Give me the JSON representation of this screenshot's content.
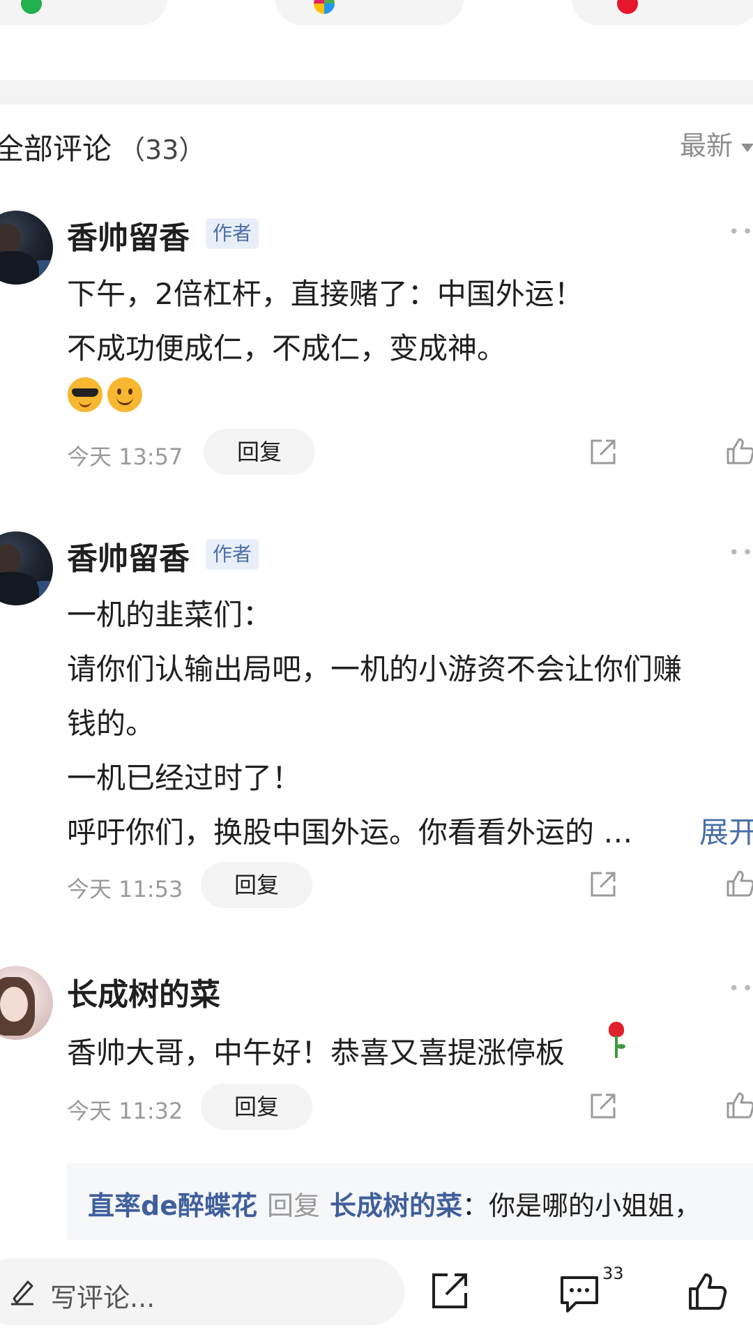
{
  "section": {
    "title": "全部评论",
    "count": "（33）",
    "sort_label": "最新"
  },
  "comments": [
    {
      "username": "香帅留香",
      "badge": "作者",
      "lines": [
        "下午，2倍杠杆，直接赌了：中国外运！",
        "不成功便成仁，不成仁，变成神。"
      ],
      "emojis": [
        "cool-face-emoji",
        "smile-emoji"
      ],
      "time": "今天 13:57",
      "reply_label": "回复"
    },
    {
      "username": "香帅留香",
      "badge": "作者",
      "lines": [
        "一机的韭菜们：",
        "请你们认输出局吧，一机的小游资不会让你们赚",
        "钱的。",
        "一机已经过时了！",
        "呼吁你们，换股中国外运。你看看外运的 …"
      ],
      "expand_label": "展开",
      "time": "今天 11:53",
      "reply_label": "回复"
    },
    {
      "username": "长成树的菜",
      "lines": [
        "香帅大哥，中午好！恭喜又喜提涨停板"
      ],
      "emojis": [
        "rose-emoji"
      ],
      "time": "今天 11:32",
      "reply_label": "回复"
    }
  ],
  "sub_reply": {
    "from": "直率de醉蝶花",
    "verb": "回复",
    "to": "长成树的菜",
    "text": "：你是哪的小姐姐，"
  },
  "bottom_bar": {
    "placeholder": "写评论...",
    "comment_count": "33"
  },
  "colors": {
    "link_blue": "#3f5f9c",
    "badge_bg": "#e9eff8",
    "gray_text": "#9a9a9a",
    "pill_bg": "#f4f4f5"
  }
}
